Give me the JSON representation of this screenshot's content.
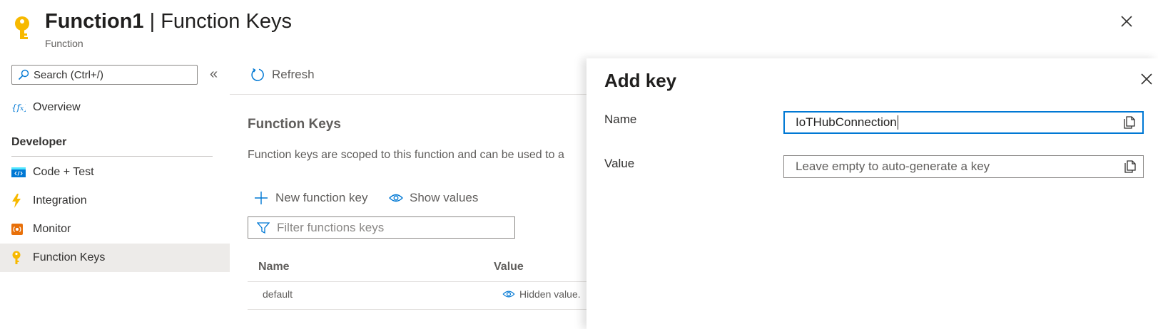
{
  "header": {
    "title_bold": "Function1",
    "title_rest": " | Function Keys",
    "subtitle": "Function"
  },
  "sidebar": {
    "search_placeholder": "Search (Ctrl+/)",
    "collapse_label": "«",
    "items": [
      {
        "label": "Overview",
        "icon": "function-icon"
      },
      {
        "label": "Code + Test",
        "icon": "code-icon"
      },
      {
        "label": "Integration",
        "icon": "lightning-icon"
      },
      {
        "label": "Monitor",
        "icon": "monitor-icon"
      },
      {
        "label": "Function Keys",
        "icon": "key-icon",
        "selected": true
      }
    ],
    "group_label": "Developer"
  },
  "main": {
    "toolbar": {
      "refresh_label": "Refresh"
    },
    "section_title": "Function Keys",
    "section_desc": "Function keys are scoped to this function and can be used to a",
    "new_key_label": "New function key",
    "show_values_label": "Show values",
    "filter_placeholder": "Filter functions keys",
    "table": {
      "columns": [
        "Name",
        "Value"
      ],
      "rows": [
        {
          "name": "default",
          "value": "Hidden value."
        }
      ]
    }
  },
  "panel": {
    "title": "Add key",
    "name_label": "Name",
    "name_value": "IoTHubConnection",
    "value_label": "Value",
    "value_placeholder": "Leave empty to auto-generate a key"
  },
  "colors": {
    "accent": "#0078d4",
    "key_yellow": "#f7b900",
    "selected_bg": "#edebe9"
  }
}
